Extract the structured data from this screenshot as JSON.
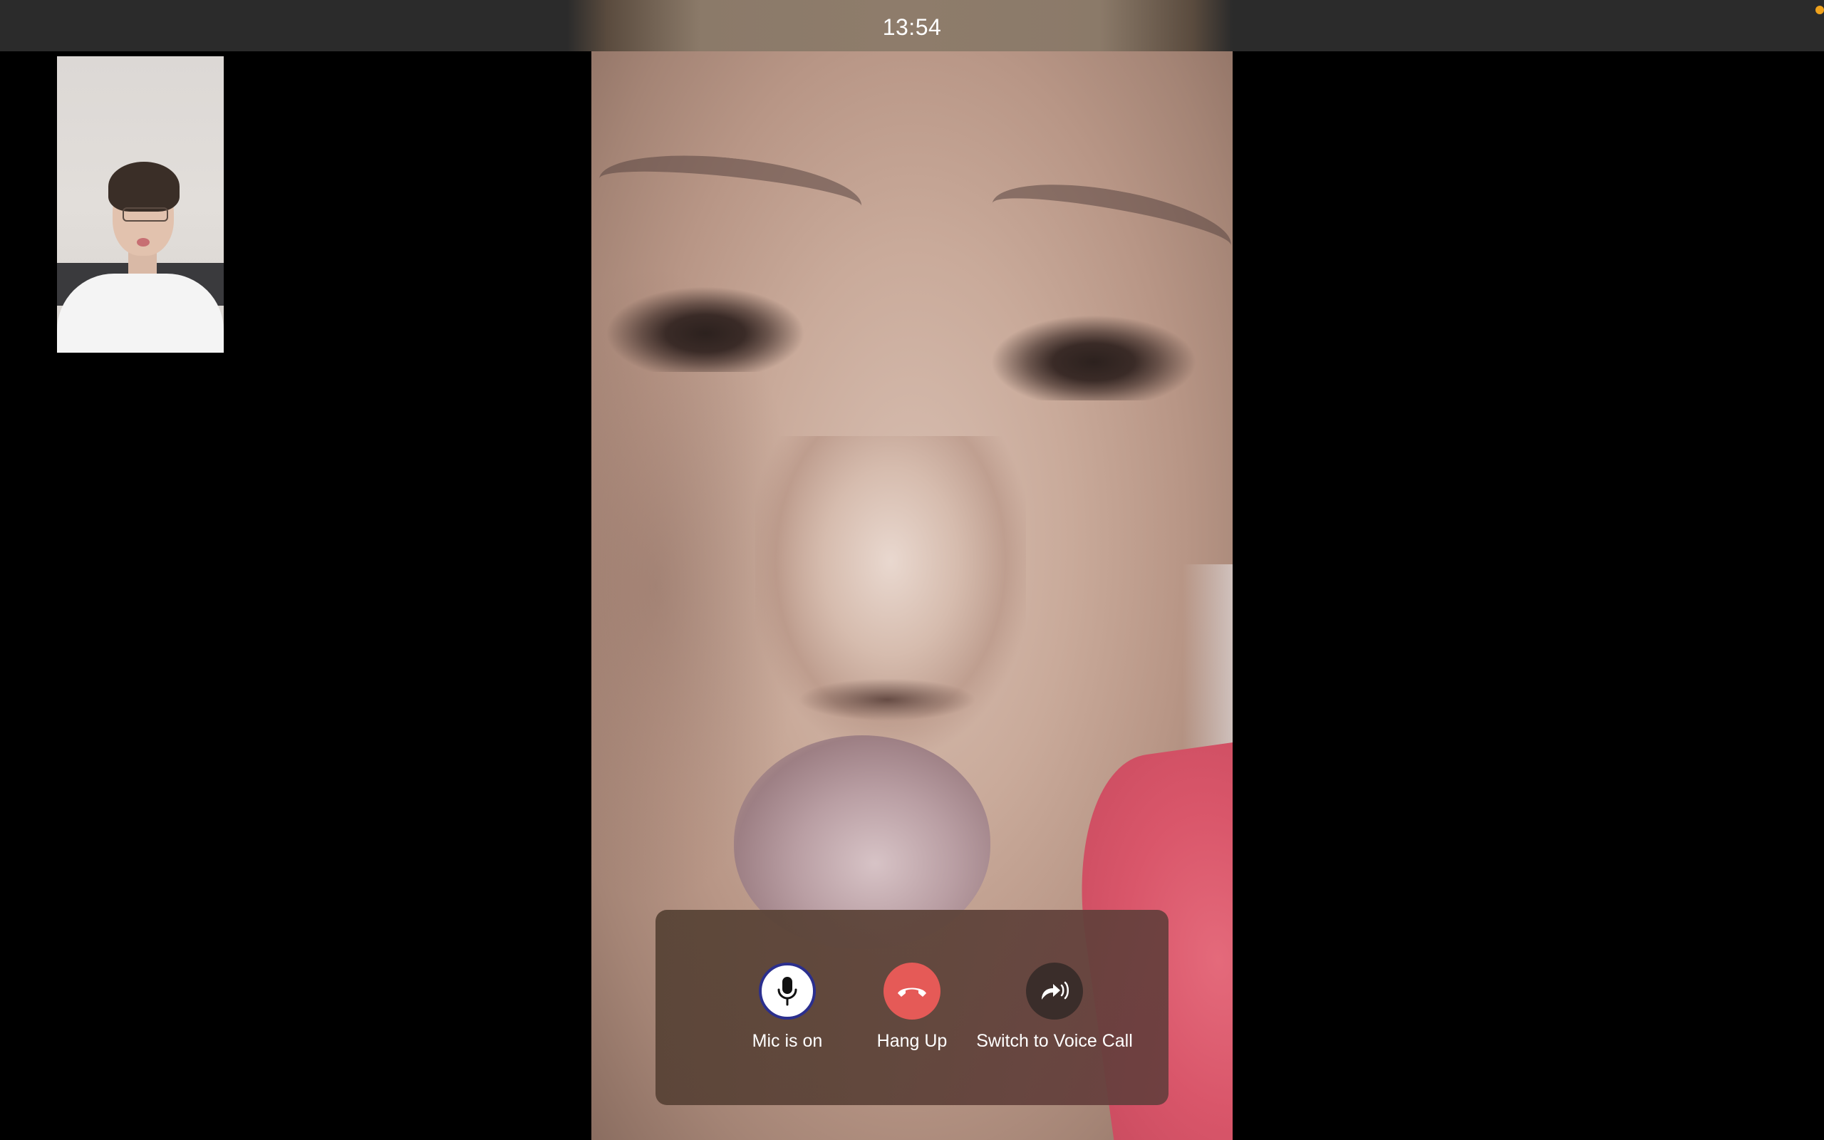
{
  "call": {
    "elapsed_time": "13:54"
  },
  "controls": {
    "mic_label": "Mic is on",
    "hangup_label": "Hang Up",
    "switch_label": "Switch to Voice Call"
  },
  "icons": {
    "mic": "microphone-icon",
    "hangup": "phone-hangup-icon",
    "switch": "voice-call-switch-icon"
  },
  "colors": {
    "hangup": "#e55a57",
    "mic_ring": "#2b2f8e",
    "status_dot": "#f0a21c"
  }
}
